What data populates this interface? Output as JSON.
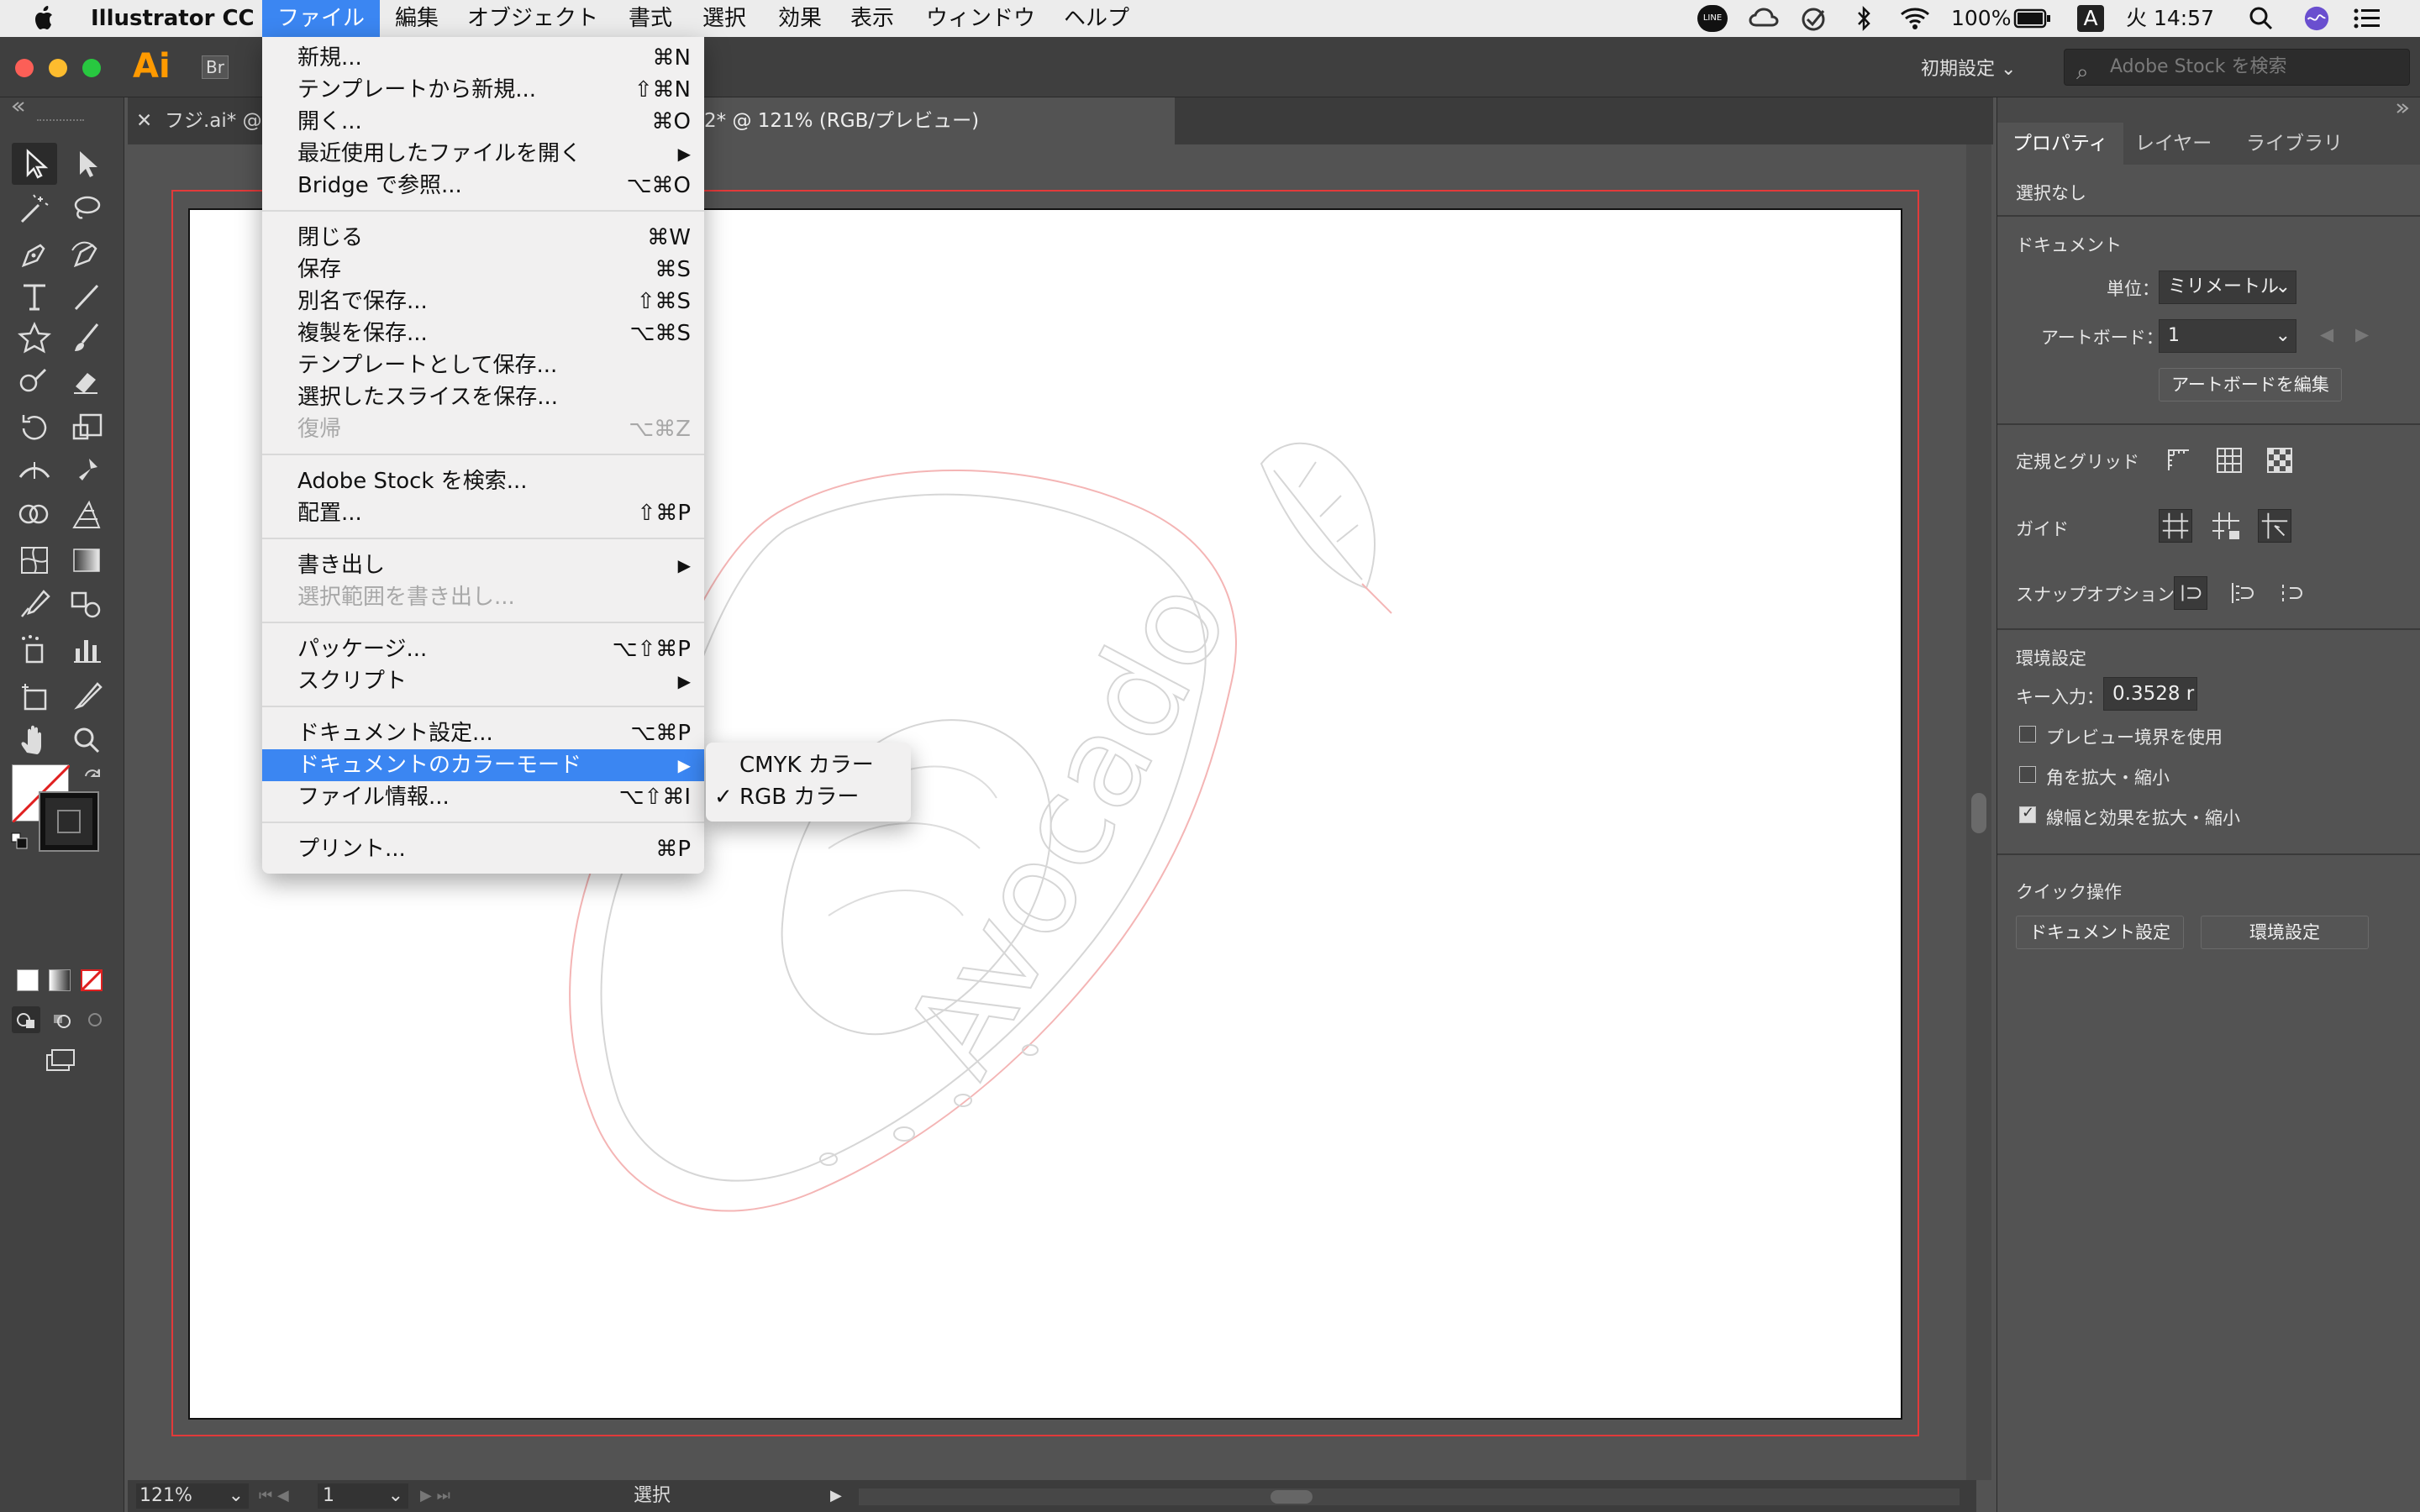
{
  "menubar": {
    "app_name": "Illustrator CC",
    "items": [
      "ファイル",
      "編集",
      "オブジェクト",
      "書式",
      "選択",
      "効果",
      "表示",
      "ウィンドウ",
      "ヘルプ"
    ],
    "battery": "100%",
    "input_mode": "A",
    "clock": "火 14:57",
    "line_badge": "LINE"
  },
  "app": {
    "logo": "Ai",
    "bridge": "Br",
    "workspace_label": "初期設定 ⌄",
    "stock_placeholder": "Adobe Stock を検索"
  },
  "tabs": {
    "tab1": "フジ.ai* @",
    "tab2": "2* @ 121% (RGB/プレビュー)"
  },
  "file_menu": {
    "items": [
      {
        "label": "新規...",
        "shortcut": "⌘N"
      },
      {
        "label": "テンプレートから新規...",
        "shortcut": "⇧⌘N"
      },
      {
        "label": "開く...",
        "shortcut": "⌘O"
      },
      {
        "label": "最近使用したファイルを開く",
        "shortcut": "▶"
      },
      {
        "label": "Bridge で参照...",
        "shortcut": "⌥⌘O"
      },
      {
        "label": "閉じる",
        "shortcut": "⌘W"
      },
      {
        "label": "保存",
        "shortcut": "⌘S"
      },
      {
        "label": "別名で保存...",
        "shortcut": "⇧⌘S"
      },
      {
        "label": "複製を保存...",
        "shortcut": "⌥⌘S"
      },
      {
        "label": "テンプレートとして保存...",
        "shortcut": ""
      },
      {
        "label": "選択したスライスを保存...",
        "shortcut": ""
      },
      {
        "label": "復帰",
        "shortcut": "⌥⌘Z"
      },
      {
        "label": "Adobe Stock を検索...",
        "shortcut": ""
      },
      {
        "label": "配置...",
        "shortcut": "⇧⌘P"
      },
      {
        "label": "書き出し",
        "shortcut": "▶"
      },
      {
        "label": "選択範囲を書き出し...",
        "shortcut": ""
      },
      {
        "label": "パッケージ...",
        "shortcut": "⌥⇧⌘P"
      },
      {
        "label": "スクリプト",
        "shortcut": "▶"
      },
      {
        "label": "ドキュメント設定...",
        "shortcut": "⌥⌘P"
      },
      {
        "label": "ドキュメントのカラーモード",
        "shortcut": "▶"
      },
      {
        "label": "ファイル情報...",
        "shortcut": "⌥⇧⌘I"
      },
      {
        "label": "プリント...",
        "shortcut": "⌘P"
      }
    ]
  },
  "color_mode_submenu": {
    "items": [
      {
        "label": "CMYK カラー",
        "check": ""
      },
      {
        "label": "RGB カラー",
        "check": "✓"
      }
    ]
  },
  "artwork": {
    "text": "Avocado"
  },
  "status": {
    "zoom": "121%",
    "artboard": "1",
    "tool": "選択"
  },
  "panel": {
    "tabs": [
      "プロパティ",
      "レイヤー",
      "ライブラリ"
    ],
    "no_selection": "選択なし",
    "document_heading": "ドキュメント",
    "units_label": "単位：",
    "units_value": "ミリメートル",
    "artboard_label": "アートボード：",
    "artboard_value": "1",
    "edit_artboard": "アートボードを編集",
    "rulers_label": "定規とグリッド",
    "guides_label": "ガイド",
    "snap_label": "スナップオプション",
    "prefs_heading": "環境設定",
    "key_input_label": "キー入力：",
    "key_input_value": "0.3528 r",
    "chk_preview": "プレビュー境界を使用",
    "chk_corners": "角を拡大・縮小",
    "chk_strokes": "線幅と効果を拡大・縮小",
    "quick_heading": "クイック操作",
    "btn_doc_setup": "ドキュメント設定",
    "btn_prefs": "環境設定"
  },
  "colors": {
    "menu_highlight": "#3b86f2",
    "app_bg": "#535353",
    "bleed": "#e23a3a",
    "logo": "#ff9a00"
  }
}
